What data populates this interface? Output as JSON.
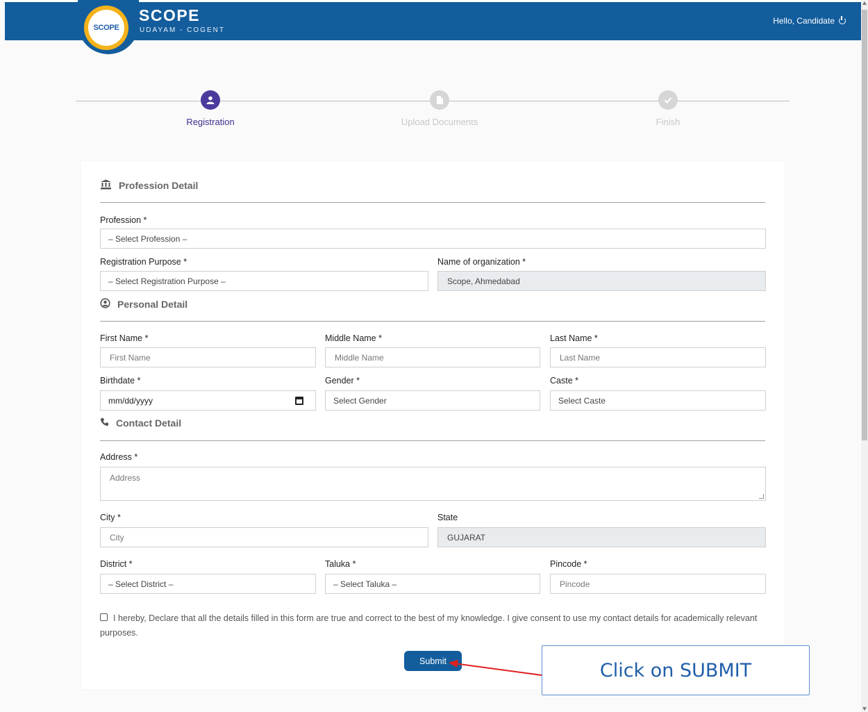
{
  "header": {
    "logo_text": "SCOPE",
    "brand_title": "SCOPE",
    "brand_subtitle": "UDAYAM - COGENT",
    "greeting": "Hello, Candidate"
  },
  "stepper": {
    "steps": [
      {
        "label": "Registration",
        "state": "active"
      },
      {
        "label": "Upload Documents",
        "state": "inactive"
      },
      {
        "label": "Finish",
        "state": "inactive"
      }
    ]
  },
  "profession": {
    "section_title": "Profession Detail",
    "profession_label": "Profession *",
    "profession_value": "– Select Profession –",
    "purpose_label": "Registration Purpose *",
    "purpose_value": "– Select Registration Purpose –",
    "org_label": "Name of organization *",
    "org_value": "Scope, Ahmedabad"
  },
  "personal": {
    "section_title": "Personal Detail",
    "first_label": "First Name *",
    "first_placeholder": "First Name",
    "middle_label": "Middle Name *",
    "middle_placeholder": "Middle Name",
    "last_label": "Last Name *",
    "last_placeholder": "Last Name",
    "birth_label": "Birthdate *",
    "birth_value": "mm/dd/yyyy",
    "gender_label": "Gender *",
    "gender_value": "Select Gender",
    "caste_label": "Caste *",
    "caste_value": "Select Caste"
  },
  "contact": {
    "section_title": "Contact Detail",
    "address_label": "Address *",
    "address_placeholder": "Address",
    "city_label": "City *",
    "city_placeholder": "City",
    "state_label": "State",
    "state_value": "GUJARAT",
    "district_label": "District *",
    "district_value": "– Select District –",
    "taluka_label": "Taluka *",
    "taluka_value": "– Select Taluka –",
    "pincode_label": "Pincode *",
    "pincode_placeholder": "Pincode"
  },
  "declaration": "I hereby, Declare that all the details filled in this form are true and correct to the best of my knowledge. I give consent to use my contact details for academically relevant purposes.",
  "submit_label": "Submit",
  "callout_text": "Click on SUBMIT",
  "colors": {
    "header": "#135d9d",
    "active_step": "#4b3a9e",
    "callout_text": "#1f5ea8",
    "arrow": "#e02020"
  }
}
